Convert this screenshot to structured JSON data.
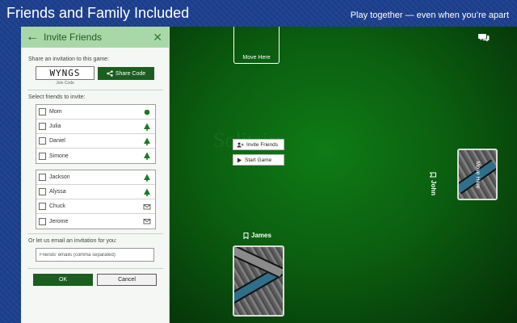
{
  "header": {
    "title": "Friends and Family Included",
    "tagline": "Play together — even when you’re apart"
  },
  "panel": {
    "title": "Invite Friends",
    "back_icon": "arrow-left-icon",
    "close_icon": "close-icon",
    "share_label": "Share an invitation to this game:",
    "join_code": "WYNGS",
    "join_code_caption": "Join Code",
    "share_button": "Share Code",
    "select_label": "Select friends to invite:",
    "friends_group1": [
      {
        "name": "Mom",
        "status": "online-dot"
      },
      {
        "name": "Julia",
        "status": "tree-icon"
      },
      {
        "name": "Daniel",
        "status": "tree-icon"
      },
      {
        "name": "Simone",
        "status": "tree-icon"
      }
    ],
    "friends_group2": [
      {
        "name": "Jackson",
        "status": "tree-icon"
      },
      {
        "name": "Alyssa",
        "status": "tree-icon"
      },
      {
        "name": "Chuck",
        "status": "envelope-icon"
      },
      {
        "name": "Jerome",
        "status": "envelope-icon"
      }
    ],
    "email_label": "Or let us email an invitation for you:",
    "email_placeholder": "Friends' emails (comma separated)",
    "ok_button": "OK",
    "cancel_button": "Cancel",
    "accent_color": "#1b5e20",
    "header_color": "#a8d8a8"
  },
  "game": {
    "move_here_top": "Move Here",
    "invite_button": "Invite Friends",
    "start_button": "Start Game",
    "player_bottom": "James",
    "player_right": "John",
    "move_here_right": "Move Here",
    "table_color": "#0b5f10"
  }
}
